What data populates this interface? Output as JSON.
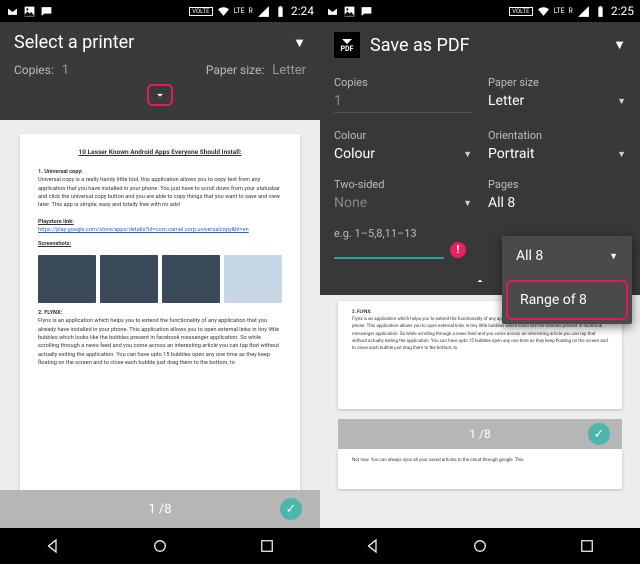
{
  "status": {
    "volte": "VOLTE",
    "lte": "LTE",
    "r": "R"
  },
  "left": {
    "time": "2:24",
    "title": "Select a printer",
    "copies_label": "Copies:",
    "copies_value": "1",
    "papersize_label": "Paper size:",
    "papersize_value": "Letter",
    "page_counter": "1 /8",
    "doc": {
      "title": "10 Lesser Known Android Apps Everyone Should Install:",
      "s1": "1.   Universal copy:",
      "s1_body": "Universal copy is a really handy little tool, this application allows you to copy text from any application that you have installed in your phone. You just have to scroll down from your statusbar and click the universal copy button and you are able to copy things that you want to save and view later. This app is simple, easy and totally free with no ads!",
      "ps_label": "Playstore link:",
      "ps_link": "https://play.google.com/store/apps/details?id=com.camel.corp.universalcopy&hl=en",
      "ss_label": "Screenshots:",
      "s2": "2.   FLYNX:",
      "s2_body": "Flynx is an application which helps you to extend the functionality of any application that you already have installed in your phone. This application allows you to open external links in tiny little bubbles which looks like the bubbles present in facebook messenger application. So while scrolling through a news feed and you come across an interesting article you can tap that without actually exiting the application. You can have upto 15 bubbles open any one time as they keep floating on the screen and to close each bubble just drag them to the bottom, to"
    }
  },
  "right": {
    "time": "2:25",
    "title": "Save as PDF",
    "pdf_badge": "PDF",
    "copies_label": "Copies",
    "copies_value": "1",
    "papersize_label": "Paper size",
    "papersize_value": "Letter",
    "colour_label": "Colour",
    "colour_value": "Colour",
    "orientation_label": "Orientation",
    "orientation_value": "Portrait",
    "twosided_label": "Two-sided",
    "twosided_value": "None",
    "pages_label": "Pages",
    "pages_value": "All 8",
    "range_hint": "e.g. 1–5,8,11–13",
    "range_value": "",
    "popup_all": "All 8",
    "popup_range": "Range of 8",
    "page_counter": "1 /8",
    "doc": {
      "s2": "2.   FLYNX:",
      "s2_body": "Flynx is an application which helps you to extend the functionality of any application that you already have installed in your phone. This application allows you to open external links in tiny little bubbles which looks like the bubbles present in facebook messenger application. So while scrolling through a news feed and you come across an interesting article you can tap that without actually exiting the application. You can have upto 15 bubbles open any one time as they keep floating on the screen and to close each bubble just drag them to the bottom, to",
      "next": "Not now. You can always sync all your saved articles to the cloud through google. This"
    }
  }
}
